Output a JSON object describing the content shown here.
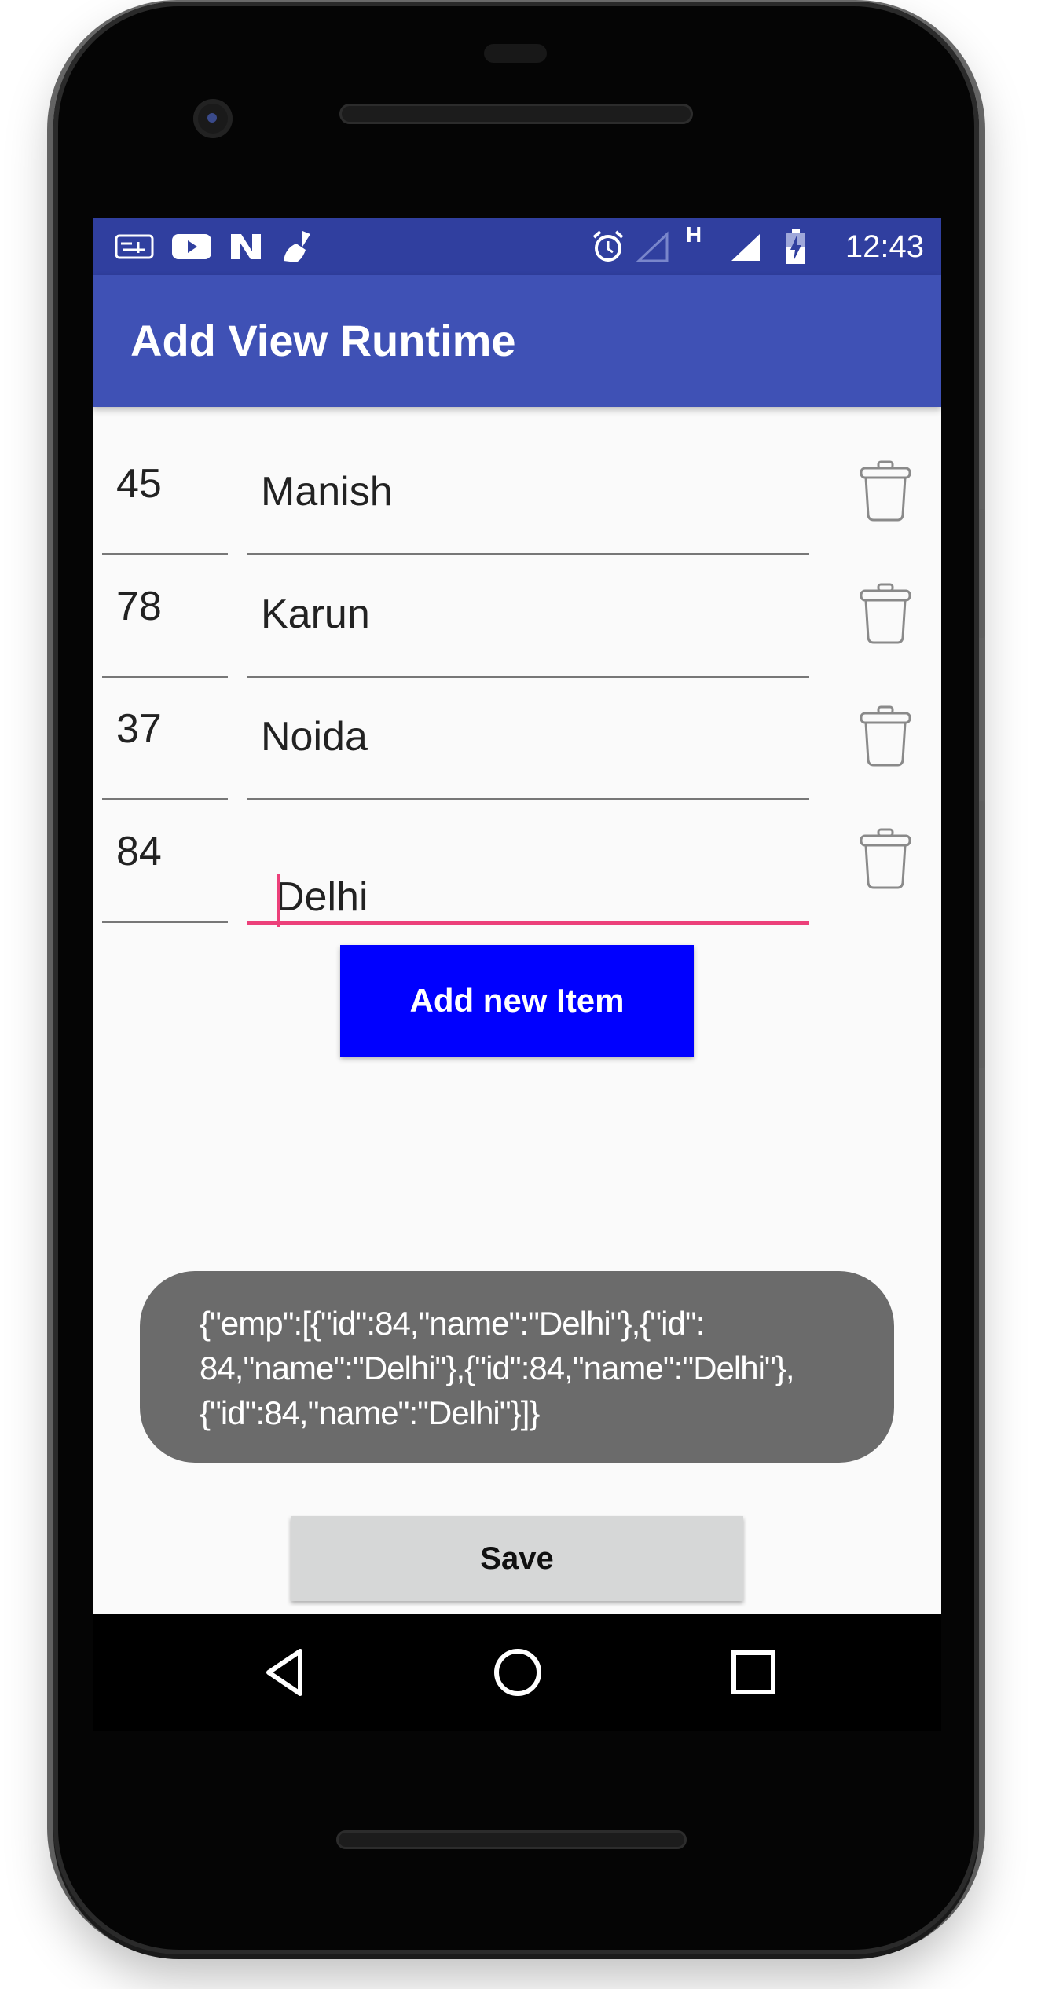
{
  "statusbar": {
    "left_icons": [
      "aaj-tak-icon",
      "youtube-icon",
      "n-icon",
      "cleaner-broom-icon"
    ],
    "right_icons": [
      "alarm-icon",
      "wifi-signal-icon",
      "h-network-icon",
      "cell-signal-icon",
      "battery-charging-icon"
    ],
    "h_label": "H",
    "time": "12:43"
  },
  "appbar": {
    "title": "Add View Runtime"
  },
  "rows": [
    {
      "id": "45",
      "name": "Manish"
    },
    {
      "id": "78",
      "name": "Karun"
    },
    {
      "id": "37",
      "name": "Noida"
    },
    {
      "id": "84",
      "name": "Delhi"
    }
  ],
  "add_button": {
    "label": "Add new Item"
  },
  "toast": {
    "line1": "{\"emp\":[{\"id\":84,\"name\":\"Delhi\"},{\"id\":",
    "line2": "84,\"name\":\"Delhi\"},{\"id\":84,\"name\":\"Delhi\"},",
    "line3": "{\"id\":84,\"name\":\"Delhi\"}]}"
  },
  "save_button": {
    "label": "Save"
  },
  "navbar": {
    "icons": [
      "back-icon",
      "home-icon",
      "recents-icon"
    ]
  },
  "colors": {
    "statusbar": "#303f9f",
    "appbar": "#3f51b5",
    "accent": "#ec407a",
    "add_button": "#0000ff",
    "toast": "#6b6b6b",
    "save_button": "#d6d7d7"
  }
}
